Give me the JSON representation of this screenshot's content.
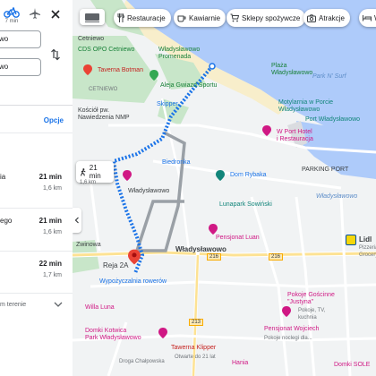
{
  "panel": {
    "bike_mode_time": "7 min",
    "field_from": "wo",
    "field_to": "wo",
    "options_label": "Opcje",
    "routes": [
      {
        "name": "ia",
        "time": "21 min",
        "distance": "1,6 km"
      },
      {
        "name": "ego",
        "time": "21 min",
        "distance": "1,6 km"
      },
      {
        "name": "",
        "time": "22 min",
        "distance": "1,7 km"
      }
    ],
    "terrain_label": "m terenie"
  },
  "chips": [
    {
      "label": "Restauracje",
      "icon": "fork-knife-icon"
    },
    {
      "label": "Kawiarnie",
      "icon": "coffee-icon"
    },
    {
      "label": "Sklepy spożywcze",
      "icon": "cart-icon"
    },
    {
      "label": "Atrakcje",
      "icon": "camera-icon"
    },
    {
      "label": "Wi",
      "icon": "bed-icon"
    }
  ],
  "map": {
    "labels": {
      "cetniewo_top": "Cetniewo",
      "cds_opo": "CDS OPO Cetniewo",
      "wladyslawowo_promenada": "Władysławowo\nPromenada",
      "plaza_wladyslawowo": "Plaża\nWładysławowo",
      "taverna": "Taverna Botman",
      "aleja_gwiazd": "Aleja Gwiazd Sportu",
      "cetniewo_road": "CETNIEWO",
      "skipper": "Skipper",
      "park_n_surf": "Park N' Surf",
      "kosciol": "Kościół pw.\nNawiedzenia NMP",
      "motylarnia": "Motylarnia w Porcie\nWładysławowo",
      "port": "Port Władysławowo",
      "port_hotel": "W Port Hotel\ni Restauracja",
      "biedronka": "Biedronka",
      "dom_rybaka": "Dom Rybaka",
      "parking": "PARKING PORT",
      "wladyslawowo_small": "Władysławowo",
      "lunapark": "Lunapark Sowiński",
      "rzeka_wladyslawowo": "Władysławowo",
      "pensjonat_luan": "Pensjonat Luan",
      "lidl": "Lidl",
      "lidl_sub": "Pizzeria\nGrocery",
      "wladyslawowo_town": "Władysławowo",
      "zwinowa": "Zwinowa",
      "reja": "Reja 2A",
      "wypozyczalnia": "Wypożyczalnia rowerów",
      "willa_luna": "Willa Luna",
      "pokoje": "Pokoje Gościnne\n\"Justyna\"",
      "pokoje_sub": "Pokoje, TV,\nkuchnia",
      "domki_kotwica": "Domki Kotwica\nPark Władysławowo",
      "pensjonat_wojciech": "Pensjonat Wojciech",
      "wojciech_sub": "Pokoje noclegi dla...",
      "tawerna_klipper": "Tawerna Klipper",
      "tawerna_sub": "Otwarte do 21 lat",
      "droga_chalpowska": "Droga Chałpowska",
      "hania": "Hania",
      "domki_bottom": "Domki SOLE"
    },
    "road_shields": [
      "216",
      "216",
      "213"
    ],
    "route_bubble": {
      "time": "21 min",
      "distance": "1,6 km"
    }
  },
  "colors": {
    "route_blue": "#1a73e8",
    "alt_route_gray": "#9aa0a6",
    "sea": "#aecbfa",
    "beach": "#f8eecb",
    "green": "#c8e6c9"
  }
}
